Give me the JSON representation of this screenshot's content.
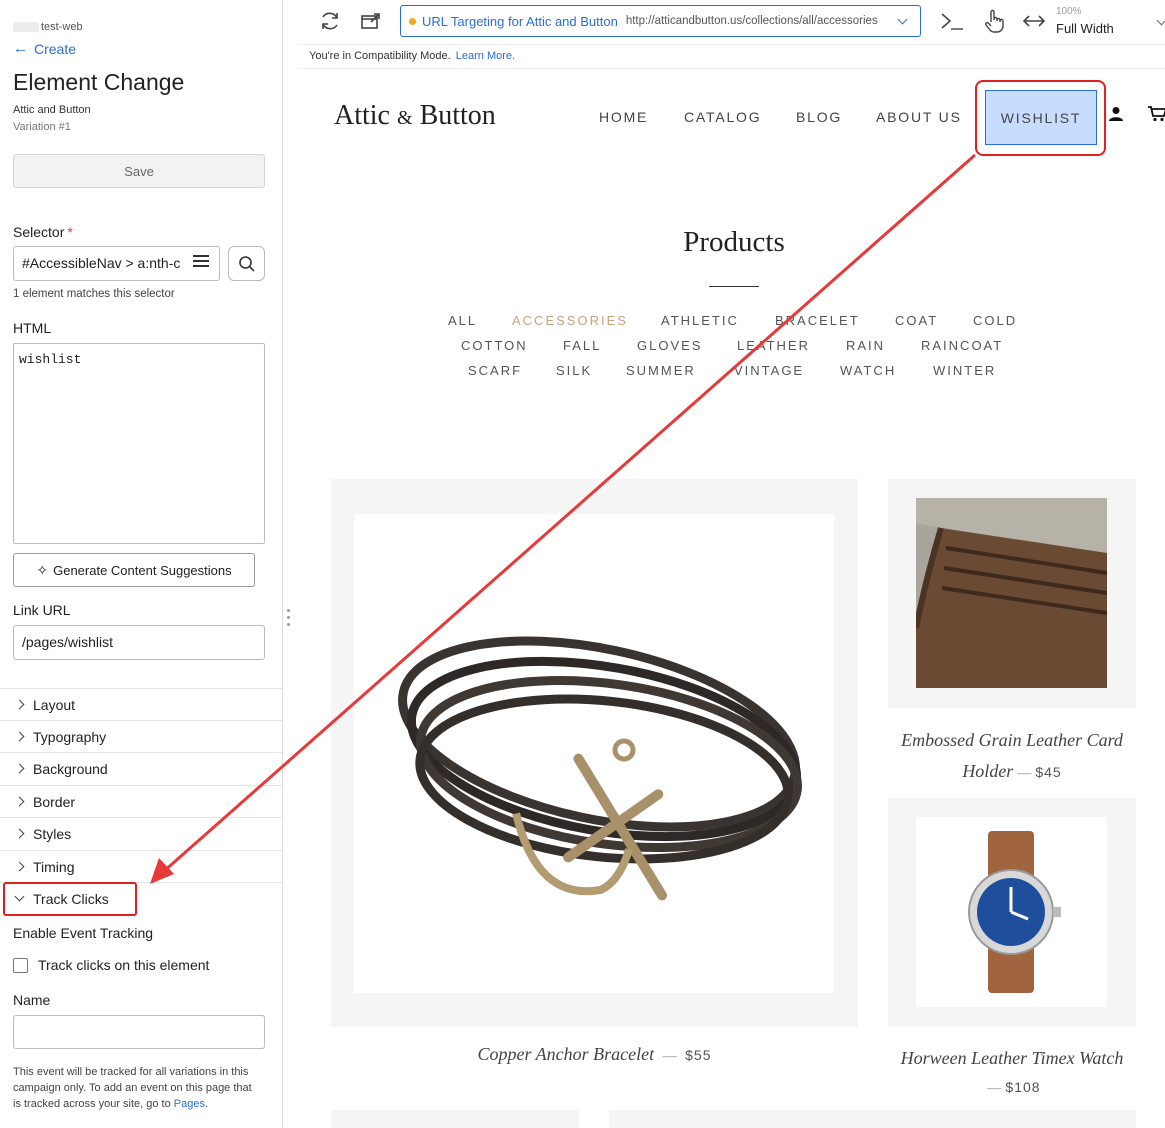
{
  "sidebar": {
    "account": "test-web",
    "back_label": "Create",
    "title": "Element Change",
    "campaign": "Attic and Button",
    "variation": "Variation #1",
    "save_label": "Save",
    "selector_label": "Selector",
    "required_mark": "*",
    "selector_value": "#AccessibleNav > a:nth-c",
    "match_text": "1 element matches this selector",
    "html_label": "HTML",
    "html_value": "wishlist",
    "generate_label": "Generate Content Suggestions",
    "link_url_label": "Link URL",
    "link_url_value": "/pages/wishlist",
    "sections": [
      "Layout",
      "Typography",
      "Background",
      "Border",
      "Styles",
      "Timing"
    ],
    "track_clicks_label": "Track Clicks",
    "enable_tracking_label": "Enable Event Tracking",
    "track_checkbox_label": "Track clicks on this element",
    "track_checked": false,
    "name_label": "Name",
    "name_value": "",
    "note_text": "This event will be tracked for all variations in this campaign only. To add an event on this page that is tracked across your site, go to",
    "note_link": "Pages",
    "note_end": "."
  },
  "toolbar": {
    "url_target_name": "URL Targeting for Attic and Button",
    "url": "http://atticandbutton.us/collections/all/accessories",
    "zoom": "100%",
    "view_mode": "Full Width"
  },
  "compat": {
    "text": "You're in Compatibility Mode.",
    "link": "Learn More."
  },
  "site": {
    "logo_main": "Attic",
    "logo_amp": "&",
    "logo_end": "Button",
    "nav": [
      "HOME",
      "CATALOG",
      "BLOG",
      "ABOUT US"
    ],
    "wishlist": "WISHLIST",
    "heading": "Products",
    "tags_row1": [
      "ALL",
      "ACCESSORIES",
      "ATHLETIC",
      "BRACELET",
      "COAT",
      "COLD"
    ],
    "tags_row2": [
      "COTTON",
      "FALL",
      "GLOVES",
      "LEATHER",
      "RAIN",
      "RAINCOAT"
    ],
    "tags_row3": [
      "SCARF",
      "SILK",
      "SUMMER",
      "VINTAGE",
      "WATCH",
      "WINTER"
    ],
    "active_tag": "ACCESSORIES",
    "products": [
      {
        "title": "Copper Anchor Bracelet",
        "price": "$55"
      },
      {
        "title_line1": "Embossed Grain Leather Card",
        "title_line2": "Holder",
        "price": "$45"
      },
      {
        "title": "Horween Leather Timex Watch",
        "price": "$108"
      }
    ],
    "dash": "—"
  },
  "colors": {
    "accent": "#2a6fd6",
    "annotation_red": "#e02020",
    "active_tag": "#c8a17f",
    "wishlist_highlight": "#c7dcff"
  }
}
